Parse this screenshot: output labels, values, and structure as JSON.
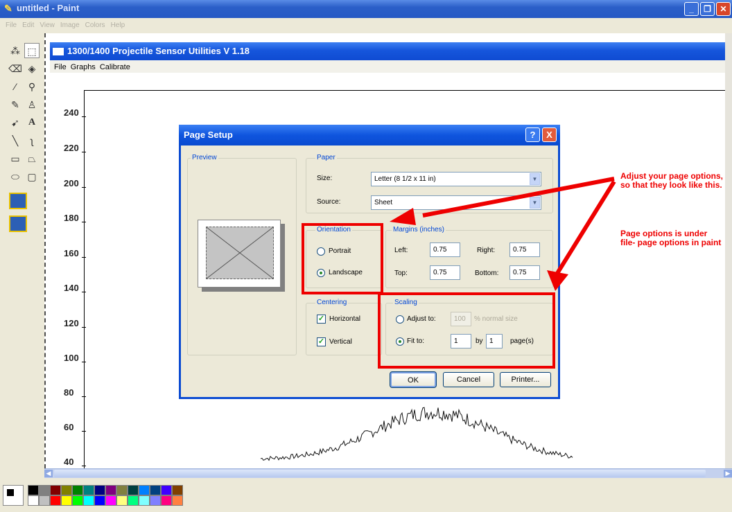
{
  "paint": {
    "title": "untitled - Paint",
    "menu": [
      "File",
      "Edit",
      "View",
      "Image",
      "Colors",
      "Help"
    ]
  },
  "app": {
    "title": "1300/1400 Projectile Sensor Utilities V 1.18",
    "menu": [
      "File",
      "Graphs",
      "Calibrate"
    ]
  },
  "graph": {
    "y_ticks": [
      "240",
      "220",
      "200",
      "180",
      "160",
      "140",
      "120",
      "100",
      "80",
      "60",
      "40"
    ]
  },
  "dialog": {
    "title": "Page Setup",
    "help_label": "?",
    "close_label": "X",
    "preview_label": "Preview",
    "paper_label": "Paper",
    "size_label": "Size:",
    "size_value": "Letter (8 1/2 x 11 in)",
    "source_label": "Source:",
    "source_value": "Sheet",
    "orientation_label": "Orientation",
    "portrait_label": "Portrait",
    "landscape_label": "Landscape",
    "margins_label": "Margins (inches)",
    "left_label": "Left:",
    "left_value": "0.75",
    "right_label": "Right:",
    "right_value": "0.75",
    "top_label": "Top:",
    "top_value": "0.75",
    "bottom_label": "Bottom:",
    "bottom_value": "0.75",
    "centering_label": "Centering",
    "horizontal_label": "Horizontal",
    "vertical_label": "Vertical",
    "scaling_label": "Scaling",
    "adjust_label": "Adjust to:",
    "adjust_value": "100",
    "normal_size_label": "% normal size",
    "fit_label": "Fit to:",
    "fit_wide": "1",
    "by_label": "by",
    "fit_tall": "1",
    "pages_label": "page(s)",
    "ok_label": "OK",
    "cancel_label": "Cancel",
    "printer_label": "Printer..."
  },
  "annotation": {
    "line1": "Adjust your page options, so that they look like this.",
    "line2": "Page options is under file- page options in paint"
  },
  "palette": {
    "row1": [
      "#000000",
      "#808080",
      "#800000",
      "#808000",
      "#008000",
      "#008080",
      "#000080",
      "#800080",
      "#808040",
      "#004040",
      "#0080ff",
      "#004080",
      "#4000ff",
      "#804000"
    ],
    "row2": [
      "#ffffff",
      "#c0c0c0",
      "#ff0000",
      "#ffff00",
      "#00ff00",
      "#00ffff",
      "#0000ff",
      "#ff00ff",
      "#ffff80",
      "#00ff80",
      "#80ffff",
      "#8080ff",
      "#ff0080",
      "#ff8040"
    ]
  },
  "colors": {
    "annotation_red": "#ee0000",
    "xp_blue": "#0b4bd2"
  }
}
